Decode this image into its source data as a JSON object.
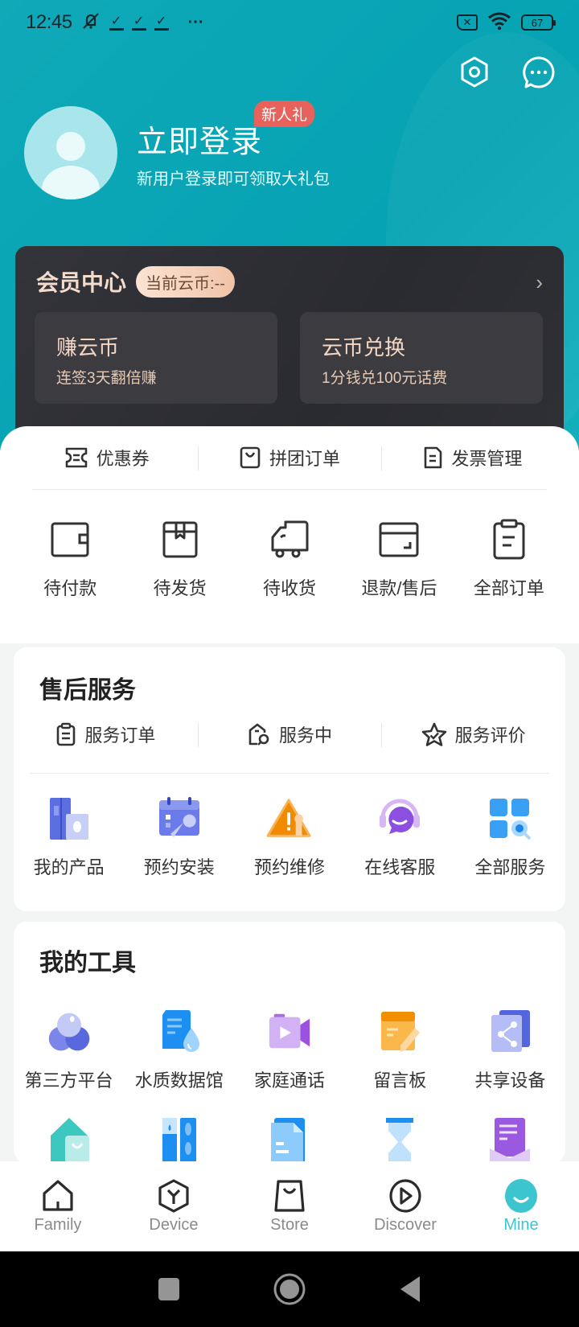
{
  "status_bar": {
    "time": "12:45",
    "more": "···",
    "battery": "67"
  },
  "header": {
    "settings_icon": "settings-hex-icon",
    "message_icon": "message-bubble-icon"
  },
  "profile": {
    "title": "立即登录",
    "subtitle": "新用户登录即可领取大礼包",
    "badge": "新人礼"
  },
  "member": {
    "title": "会员中心",
    "coin_label": "当前云币:--",
    "chevron": "›",
    "tiles": [
      {
        "title": "赚云币",
        "sub": "连签3天翻倍赚"
      },
      {
        "title": "云币兑换",
        "sub": "1分钱兑100元话费"
      }
    ]
  },
  "orders": {
    "quick": [
      {
        "label": "优惠券",
        "icon": "coupon-icon"
      },
      {
        "label": "拼团订单",
        "icon": "group-bag-icon"
      },
      {
        "label": "发票管理",
        "icon": "invoice-icon"
      }
    ],
    "items": [
      {
        "label": "待付款",
        "icon": "wallet-icon"
      },
      {
        "label": "待发货",
        "icon": "package-icon"
      },
      {
        "label": "待收货",
        "icon": "truck-icon"
      },
      {
        "label": "退款/售后",
        "icon": "refund-icon"
      },
      {
        "label": "全部订单",
        "icon": "clipboard-icon"
      }
    ]
  },
  "service": {
    "title": "售后服务",
    "quick": [
      {
        "label": "服务订单",
        "icon": "service-order-icon"
      },
      {
        "label": "服务中",
        "icon": "in-service-icon"
      },
      {
        "label": "服务评价",
        "icon": "star-review-icon"
      }
    ],
    "items": [
      {
        "label": "我的产品",
        "icon": "my-product-icon"
      },
      {
        "label": "预约安装",
        "icon": "install-calendar-icon"
      },
      {
        "label": "预约维修",
        "icon": "repair-warning-icon"
      },
      {
        "label": "在线客服",
        "icon": "customer-service-icon"
      },
      {
        "label": "全部服务",
        "icon": "all-services-icon"
      }
    ]
  },
  "tools": {
    "title": "我的工具",
    "items": [
      {
        "label": "第三方平台",
        "icon": "third-party-icon"
      },
      {
        "label": "水质数据馆",
        "icon": "water-data-icon"
      },
      {
        "label": "家庭通话",
        "icon": "video-call-icon"
      },
      {
        "label": "留言板",
        "icon": "message-board-icon"
      },
      {
        "label": "共享设备",
        "icon": "share-device-icon"
      }
    ],
    "row2_icons": [
      "home-store-icon",
      "water-meter-icon",
      "document-icon",
      "hourglass-icon",
      "notes-icon"
    ]
  },
  "bottom_nav": {
    "items": [
      {
        "label": "Family",
        "icon": "home-icon"
      },
      {
        "label": "Device",
        "icon": "device-hex-icon"
      },
      {
        "label": "Store",
        "icon": "store-bag-icon"
      },
      {
        "label": "Discover",
        "icon": "play-circle-icon"
      },
      {
        "label": "Mine",
        "icon": "mine-face-icon"
      }
    ],
    "active": "Mine",
    "active_color": "#3cc4cf"
  },
  "colors": {
    "brand_teal": "#06a3b4",
    "badge_red": "#e6625a",
    "member_dark": "#2d2e33",
    "member_gold": "#f4dccd"
  }
}
